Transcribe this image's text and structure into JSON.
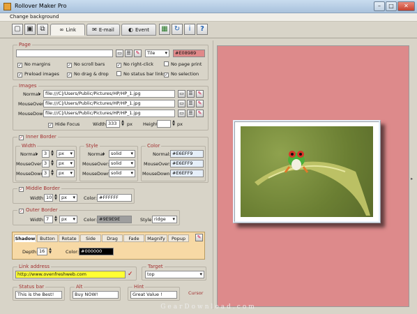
{
  "window": {
    "title": "Rollover Maker Pro"
  },
  "menu": {
    "item": "Change background"
  },
  "tabs": [
    {
      "label": "Link",
      "icon": "link-icon"
    },
    {
      "label": "E-mail",
      "icon": "email-icon"
    },
    {
      "label": "Event",
      "icon": "event-icon"
    }
  ],
  "page": {
    "legend": "Page",
    "path": "",
    "tile": "Tile",
    "color": "#E08989",
    "checkboxes": [
      {
        "label": "No margins",
        "checked": true
      },
      {
        "label": "No scroll bars",
        "checked": true
      },
      {
        "label": "No right-click",
        "checked": true
      },
      {
        "label": "No page print",
        "checked": false
      },
      {
        "label": "Preload images",
        "checked": true
      },
      {
        "label": "No drag & drop",
        "checked": true
      },
      {
        "label": "No status bar links",
        "checked": false
      },
      {
        "label": "No selection",
        "checked": true
      }
    ]
  },
  "images": {
    "legend": "Images",
    "rows": [
      {
        "label": "Normal",
        "path": "file:///C|/Users/Public/Pictures/HP/HP_1.jpg"
      },
      {
        "label": "MouseOver:",
        "path": "file:///C|/Users/Public/Pictures/HP/HP_1.jpg"
      },
      {
        "label": "MouseDown:",
        "path": "file:///C|/Users/Public/Pictures/HP/HP_1.jpg"
      }
    ],
    "hide_focus": "Hide Focus",
    "width_label": "Width:",
    "width": "333",
    "height_label": "Height:",
    "height": "",
    "px": "px"
  },
  "inner_border": {
    "legend": "Inner Border",
    "width_legend": "Width",
    "style_legend": "Style",
    "color_legend": "Color",
    "rows": [
      {
        "label": "Normal",
        "width": "3",
        "unit": "px",
        "style_label": "Normal",
        "style": "solid",
        "color_label": "Normal:",
        "color": "#E6EFF9"
      },
      {
        "label": "MouseOver:",
        "width": "3",
        "unit": "px",
        "style_label": "MouseOver:",
        "style": "solid",
        "color_label": "MouseOver:",
        "color": "#E6EFF9"
      },
      {
        "label": "MouseDown:",
        "width": "3",
        "unit": "px",
        "style_label": "MouseDown:",
        "style": "solid",
        "color_label": "MouseDown:",
        "color": "#E6EFF9"
      }
    ]
  },
  "middle_border": {
    "legend": "Middle Border",
    "width_label": "Width:",
    "width": "10",
    "unit": "px",
    "color_label": "Color:",
    "color": "#FFFFFF"
  },
  "outer_border": {
    "legend": "Outer Border",
    "width_label": "Width:",
    "width": "7",
    "unit": "px",
    "color_label": "Color:",
    "color": "#9E9E9E",
    "style_label": "Style:",
    "style": "ridge"
  },
  "effects": {
    "tabs": [
      "Shadow",
      "Button",
      "Rotate",
      "Side",
      "Drag",
      "Fade",
      "Magnify",
      "Popup"
    ],
    "depth_label": "Depth:",
    "depth": "16",
    "color_label": "Color:",
    "color": "#000000"
  },
  "link": {
    "legend": "Link address",
    "url": "http://www.ovenfreshweb.com"
  },
  "target": {
    "legend": "Target",
    "value": "top"
  },
  "status_bar": {
    "legend": "Status bar",
    "value": "This is the Best!"
  },
  "alt": {
    "legend": "Alt",
    "value": "Buy NOW!"
  },
  "hint": {
    "legend": "Hint",
    "value": "Great Value !"
  },
  "cursor": {
    "label": "Cursor"
  },
  "watermark": "GearDownload.com",
  "colors": {
    "preview_bg": "#dd8a8b",
    "highlight": "#ffff33",
    "effects_bg": "#f7d9a5",
    "legend": "#a23030"
  }
}
